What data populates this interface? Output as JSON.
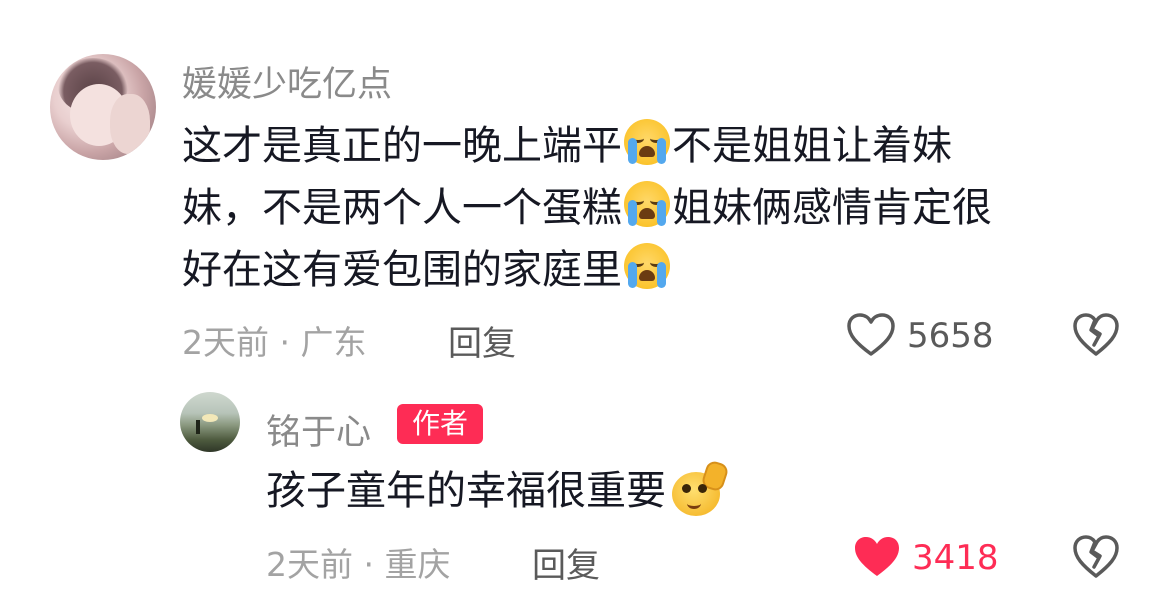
{
  "comment": {
    "username": "媛媛少吃亿点",
    "lines": [
      {
        "segments": [
          "这才是真正的一晚上端平",
          "不是姐姐让着妹"
        ]
      },
      {
        "segments": [
          "妹，不是两个人一个蛋糕",
          "姐妹俩感情肯定很"
        ]
      },
      {
        "segments": [
          "好在这有爱包围的家庭里",
          ""
        ]
      }
    ],
    "meta": "2天前 · 广东",
    "reply_label": "回复",
    "like_count": "5658",
    "emoji": "crying-face"
  },
  "reply": {
    "username": "铭于心",
    "author_tag": "作者",
    "text": "孩子童年的幸福很重要",
    "meta": "2天前 · 重庆",
    "reply_label": "回复",
    "like_count": "3418",
    "liked": true,
    "emoji": "thumbs-up-face",
    "accent_color": "#fe2c55"
  }
}
